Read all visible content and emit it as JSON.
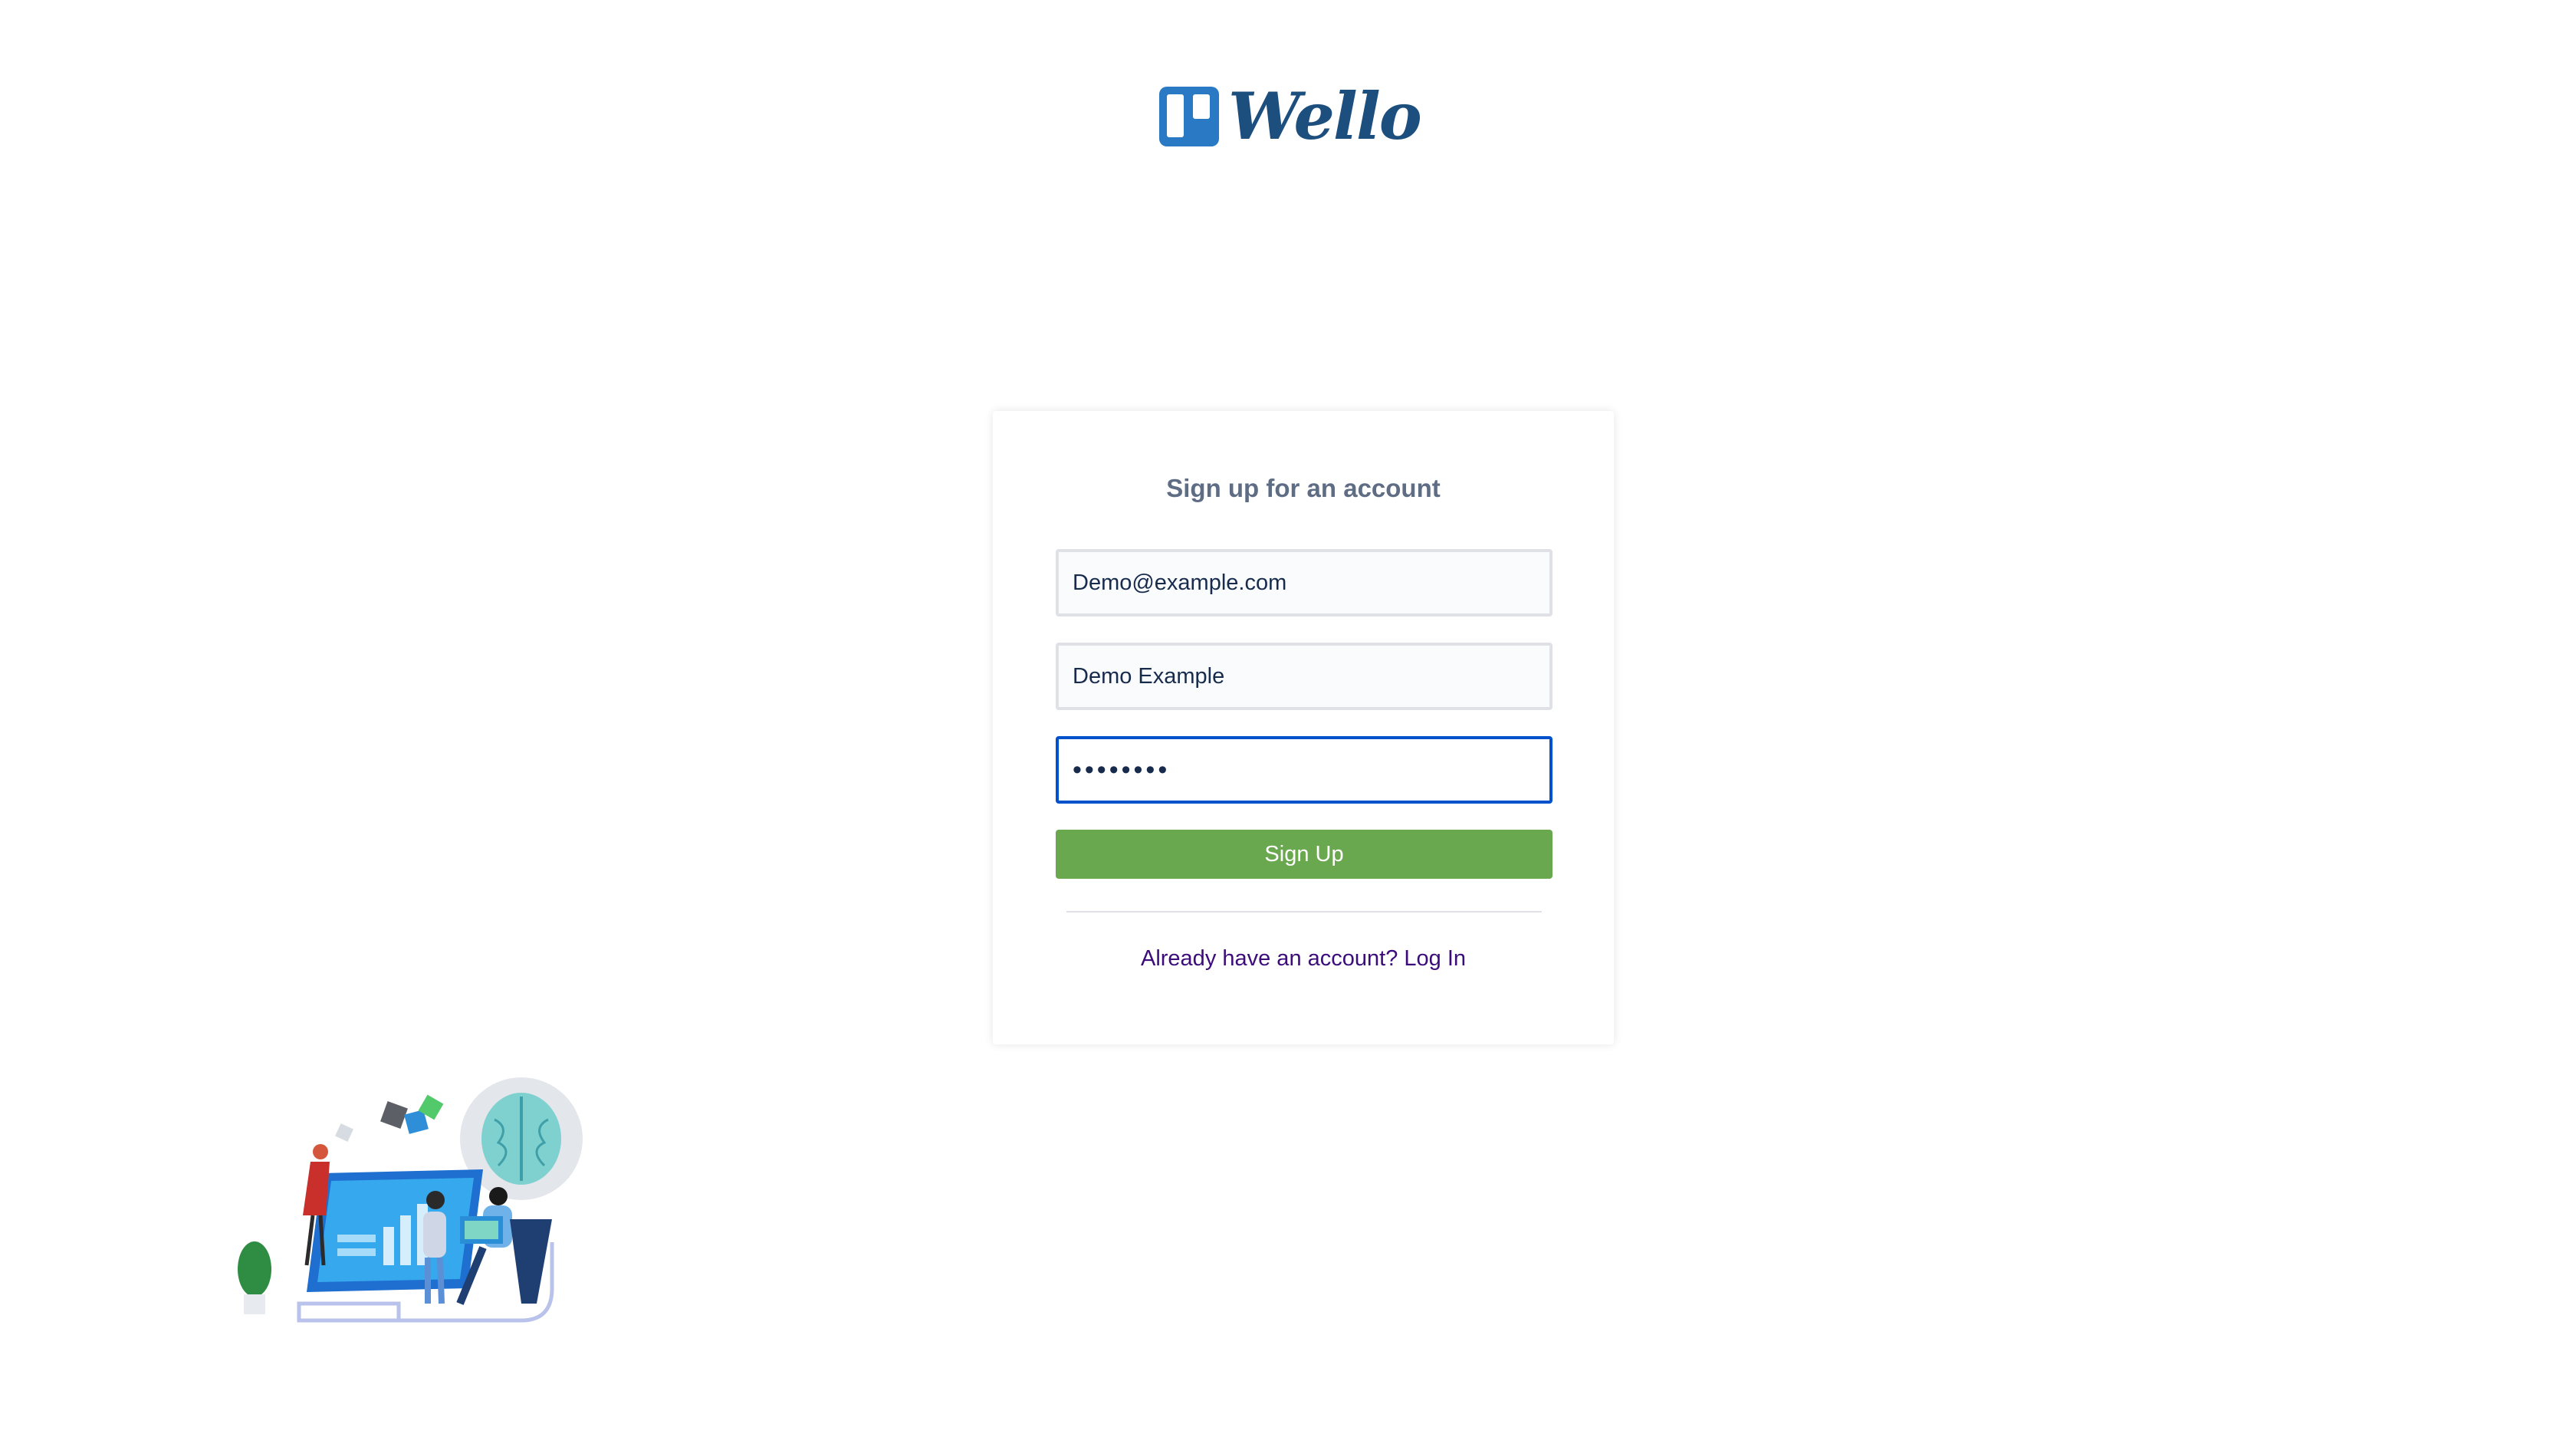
{
  "logo": {
    "text": "Wello",
    "icon": "board-columns-icon",
    "color": "#1c4e7e",
    "mark_color": "#2a79c4"
  },
  "form": {
    "title": "Sign up for an account",
    "email_value": "Demo@example.com",
    "name_value": "Demo Example",
    "password_value": "••••••••",
    "submit_label": "Sign Up",
    "login_link": "Already have an account? Log In",
    "submit_color": "#6aa84f",
    "focus_color": "#0052cc"
  },
  "illustration": {
    "icon": "team-collaboration-illustration"
  }
}
